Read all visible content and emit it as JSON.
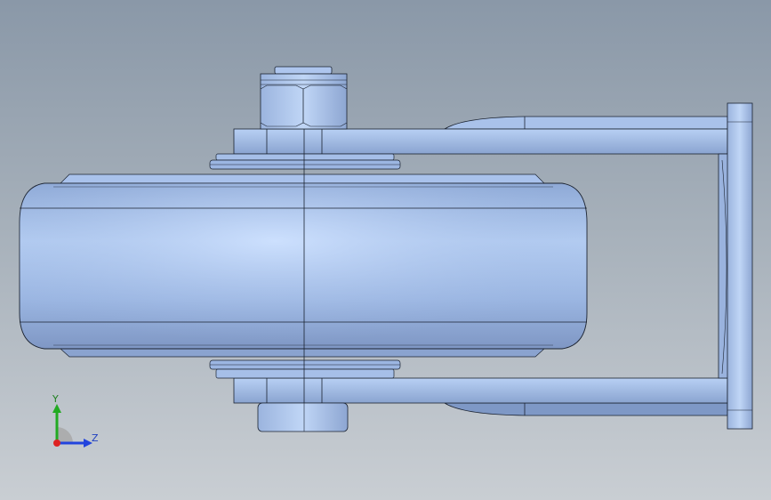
{
  "viewport": {
    "background_top": "#8a98a8",
    "background_bottom": "#c9ced3",
    "part_color": "#9db8e6",
    "edge_color": "#1a2230"
  },
  "model": {
    "description_icon": "caster-wheel-model"
  },
  "triad": {
    "y_label": "Y",
    "z_label": "Z",
    "y_color": "#22aa22",
    "z_color": "#2244dd",
    "x_color": "#dd2222"
  }
}
